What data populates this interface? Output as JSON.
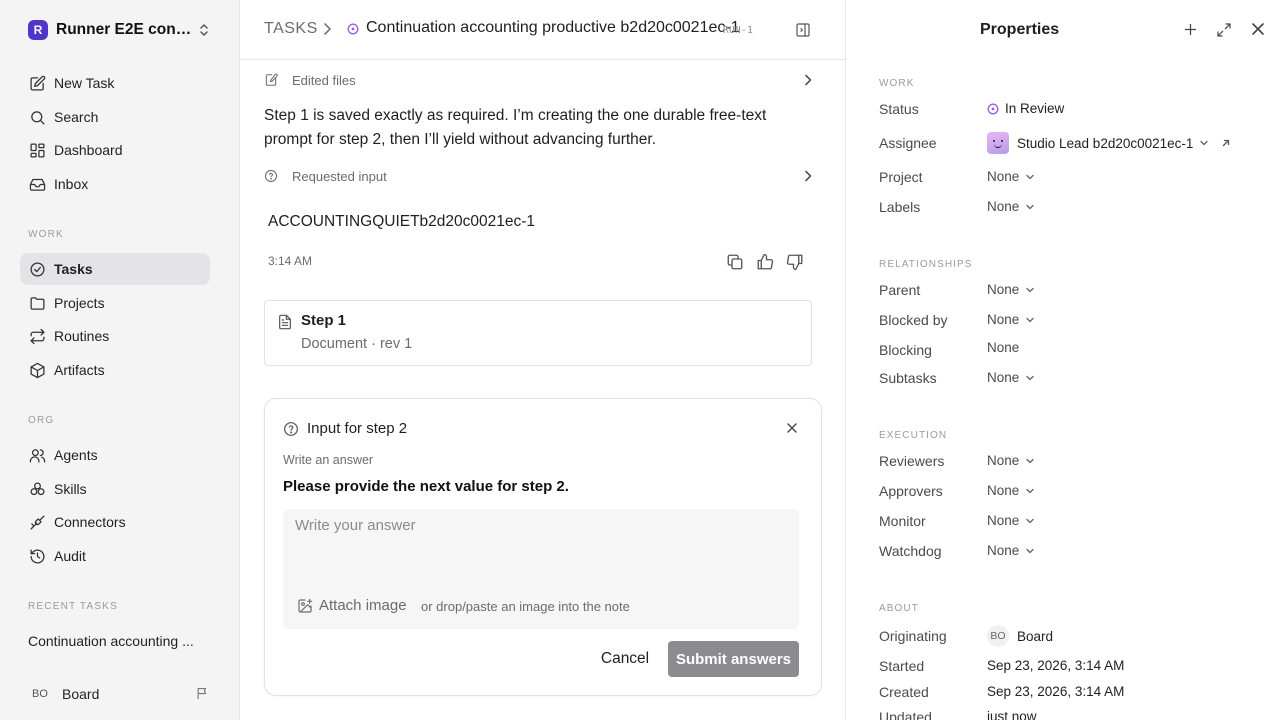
{
  "workspace": {
    "name": "Runner E2E conti...",
    "logo_letter": "R"
  },
  "nav": {
    "top": [
      {
        "label": "New Task",
        "icon": "edit-icon"
      },
      {
        "label": "Search",
        "icon": "search-icon"
      },
      {
        "label": "Dashboard",
        "icon": "dashboard-icon"
      },
      {
        "label": "Inbox",
        "icon": "inbox-icon"
      }
    ],
    "work_label": "WORK",
    "work": [
      {
        "label": "Tasks",
        "icon": "check-circle-icon",
        "active": true
      },
      {
        "label": "Projects",
        "icon": "folder-icon"
      },
      {
        "label": "Routines",
        "icon": "repeat-icon"
      },
      {
        "label": "Artifacts",
        "icon": "box-icon"
      }
    ],
    "org_label": "ORG",
    "org": [
      {
        "label": "Agents",
        "icon": "users-icon"
      },
      {
        "label": "Skills",
        "icon": "skills-icon"
      },
      {
        "label": "Connectors",
        "icon": "plug-icon"
      },
      {
        "label": "Audit",
        "icon": "history-icon"
      }
    ],
    "recent_label": "RECENT TASKS",
    "recent": [
      "Continuation accounting ..."
    ]
  },
  "user": {
    "initials": "BO",
    "name": "Board"
  },
  "breadcrumb": {
    "root": "TASKS",
    "title": "Continuation accounting productive b2d20c0021ec-1",
    "run": "RUN-1",
    "status_color": "#9b5de5"
  },
  "thread": {
    "edited_files_label": "Edited files",
    "message": "Step 1 is saved exactly as required. I’m creating the one durable free-text prompt for step 2, then I’ll yield without advancing further.",
    "requested_input_label": "Requested input",
    "answer": "ACCOUNTINGQUIETb2d20c0021ec-1",
    "time": "3:14 AM"
  },
  "document": {
    "title": "Step 1",
    "subtitle": "Document · rev 1"
  },
  "input_card": {
    "title": "Input for step 2",
    "hint": "Write an answer",
    "question": "Please provide the next value for step 2.",
    "placeholder": "Write your answer",
    "attach_label": "Attach image",
    "attach_hint": "or drop/paste an image into the note",
    "cancel_label": "Cancel",
    "submit_label": "Submit answers"
  },
  "properties": {
    "title": "Properties",
    "work_label": "WORK",
    "status_label": "Status",
    "status_value": "In Review",
    "status_color": "#9b5de5",
    "assignee_label": "Assignee",
    "assignee_value": "Studio Lead b2d20c0021ec-1",
    "project_label": "Project",
    "project_value": "None",
    "labels_label": "Labels",
    "labels_value": "None",
    "relationships_label": "RELATIONSHIPS",
    "parent_label": "Parent",
    "parent_value": "None",
    "blocked_by_label": "Blocked by",
    "blocked_by_value": "None",
    "blocking_label": "Blocking",
    "blocking_value": "None",
    "subtasks_label": "Subtasks",
    "subtasks_value": "None",
    "execution_label": "EXECUTION",
    "reviewers_label": "Reviewers",
    "reviewers_value": "None",
    "approvers_label": "Approvers",
    "approvers_value": "None",
    "monitor_label": "Monitor",
    "monitor_value": "None",
    "watchdog_label": "Watchdog",
    "watchdog_value": "None",
    "about_label": "ABOUT",
    "originating_label": "Originating",
    "originating_initials": "BO",
    "originating_value": "Board",
    "started_label": "Started",
    "started_value": "Sep 23, 2026, 3:14 AM",
    "created_label": "Created",
    "created_value": "Sep 23, 2026, 3:14 AM",
    "updated_label": "Updated",
    "updated_value": "just now"
  }
}
